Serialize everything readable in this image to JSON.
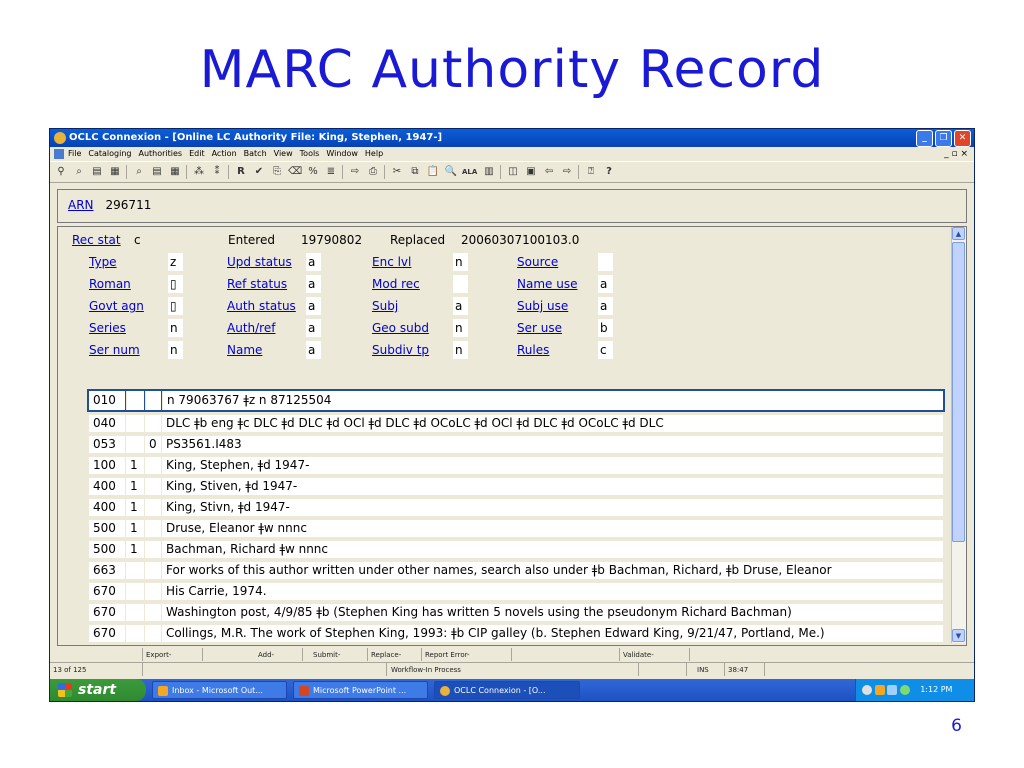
{
  "slide": {
    "title": "MARC Authority Record",
    "page_number": "6"
  },
  "window": {
    "title": "OCLC Connexion - [Online LC Authority File: King, Stephen, 1947-]",
    "menu": [
      "File",
      "Cataloging",
      "Authorities",
      "Edit",
      "Action",
      "Batch",
      "View",
      "Tools",
      "Window",
      "Help"
    ],
    "mdi_controls": "_ ▫ ×"
  },
  "arn": {
    "label": "ARN",
    "value": "296711"
  },
  "fixed_fields": {
    "rec_stat": {
      "label": "Rec stat",
      "value": "c"
    },
    "entered": {
      "label": "Entered",
      "value": "19790802"
    },
    "replaced": {
      "label": "Replaced",
      "value": "20060307100103.0"
    },
    "rows": [
      [
        {
          "label": "Type",
          "value": "z"
        },
        {
          "label": "Upd status",
          "value": "a"
        },
        {
          "label": "Enc lvl",
          "value": "n"
        },
        {
          "label": "Source",
          "value": ""
        }
      ],
      [
        {
          "label": "Roman",
          "value": "▯"
        },
        {
          "label": "Ref status",
          "value": "a"
        },
        {
          "label": "Mod rec",
          "value": ""
        },
        {
          "label": "Name use",
          "value": "a"
        }
      ],
      [
        {
          "label": "Govt agn",
          "value": "▯"
        },
        {
          "label": "Auth status",
          "value": "a"
        },
        {
          "label": "Subj",
          "value": "a"
        },
        {
          "label": "Subj use",
          "value": "a"
        }
      ],
      [
        {
          "label": "Series",
          "value": "n"
        },
        {
          "label": "Auth/ref",
          "value": "a"
        },
        {
          "label": "Geo subd",
          "value": "n"
        },
        {
          "label": "Ser use",
          "value": "b"
        }
      ],
      [
        {
          "label": "Ser num",
          "value": "n"
        },
        {
          "label": "Name",
          "value": "a"
        },
        {
          "label": "Subdiv tp",
          "value": "n"
        },
        {
          "label": "Rules",
          "value": "c"
        }
      ]
    ]
  },
  "variable_fields": [
    {
      "tag": "010",
      "ind1": "",
      "ind2": "",
      "content": "n  79063767 ǂz n  87125504"
    },
    {
      "tag": "040",
      "ind1": "",
      "ind2": "",
      "content": "DLC ǂb eng ǂc DLC ǂd DLC ǂd OCl ǂd DLC ǂd OCoLC ǂd OCl ǂd DLC ǂd OCoLC ǂd DLC"
    },
    {
      "tag": "053",
      "ind1": "",
      "ind2": "0",
      "content": "PS3561.I483"
    },
    {
      "tag": "100",
      "ind1": "1",
      "ind2": "",
      "content": "King, Stephen, ǂd 1947-"
    },
    {
      "tag": "400",
      "ind1": "1",
      "ind2": "",
      "content": "King, Stiven, ǂd 1947-"
    },
    {
      "tag": "400",
      "ind1": "1",
      "ind2": "",
      "content": "King, Stivn, ǂd 1947-"
    },
    {
      "tag": "500",
      "ind1": "1",
      "ind2": "",
      "content": "Druse, Eleanor ǂw nnnc"
    },
    {
      "tag": "500",
      "ind1": "1",
      "ind2": "",
      "content": "Bachman, Richard ǂw nnnc"
    },
    {
      "tag": "663",
      "ind1": "",
      "ind2": "",
      "content": "For works of this author written under other names, search also under ǂb Bachman, Richard, ǂb Druse, Eleanor"
    },
    {
      "tag": "670",
      "ind1": "",
      "ind2": "",
      "content": "His Carrie, 1974."
    },
    {
      "tag": "670",
      "ind1": "",
      "ind2": "",
      "content": "Washington post, 4/9/85 ǂb (Stephen King has written 5 novels using the pseudonym Richard Bachman)"
    },
    {
      "tag": "670",
      "ind1": "",
      "ind2": "",
      "content": "Collings, M.R. The work of Stephen King, 1993: ǂb CIP galley (b. Stephen Edward King, 9/21/47, Portland, Me.)"
    }
  ],
  "status": {
    "row1": [
      "",
      "Export-",
      "Add-",
      "Submit-",
      "Replace-",
      "Report Error-",
      "",
      "Validate-"
    ],
    "record_count": "13 of 125",
    "workflow": "Workflow-In Process",
    "ins": "INS",
    "position": "38:47"
  },
  "taskbar": {
    "start": "start",
    "tasks": [
      "Inbox - Microsoft Out...",
      "Microsoft PowerPoint ...",
      "OCLC Connexion - [O..."
    ],
    "clock": "1:12 PM"
  },
  "colors": {
    "slide_title": "#1a1ad6",
    "link": "#0000cc",
    "titlebar": "#0a5fd8",
    "selected_border": "#1f4f9a",
    "start_green": "#3c9a3c"
  }
}
